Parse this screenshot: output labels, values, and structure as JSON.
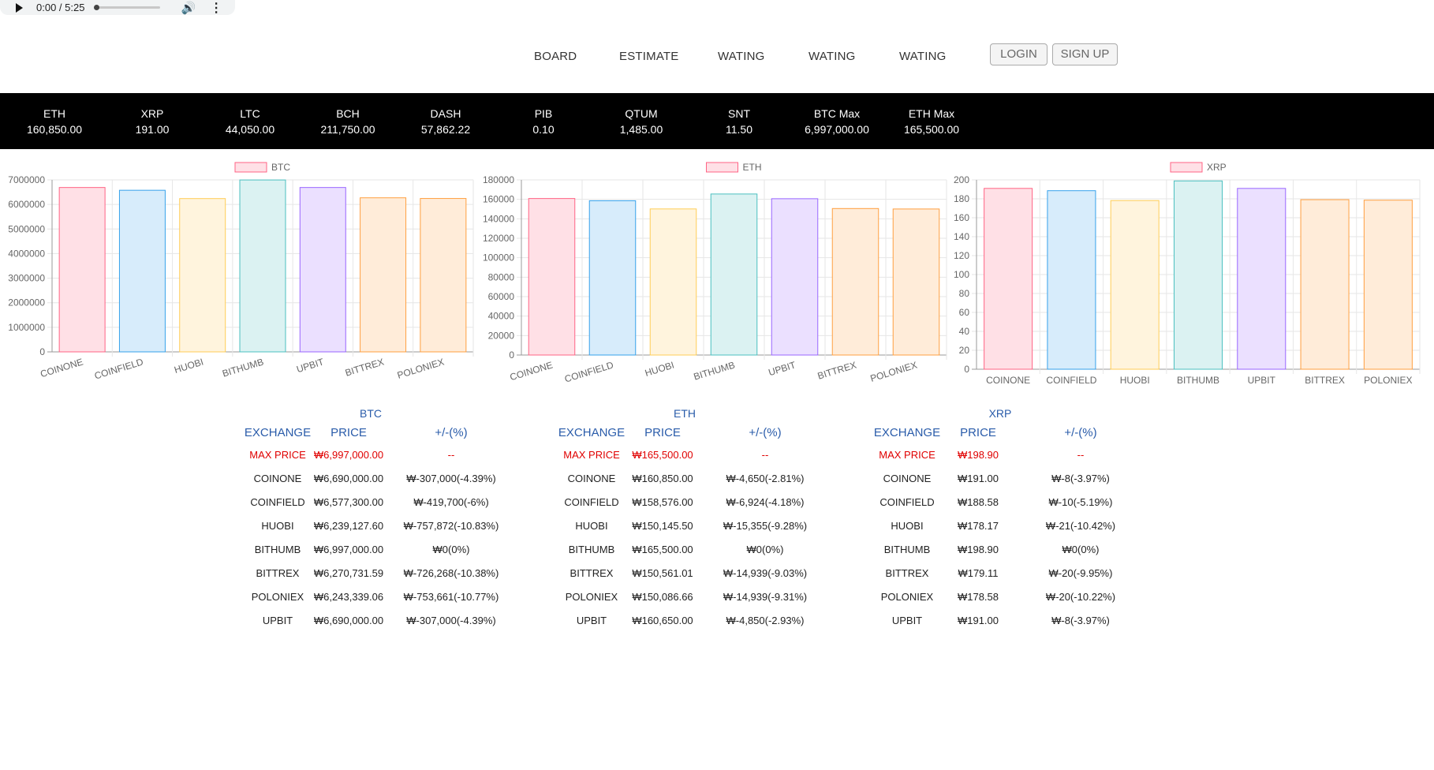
{
  "audio": {
    "time": "0:00 / 5:25"
  },
  "nav": {
    "items": [
      "BOARD",
      "ESTIMATE",
      "WATING",
      "WATING",
      "WATING"
    ],
    "login": "LOGIN",
    "signup": "SIGN UP"
  },
  "ticker": [
    {
      "name": "ETH",
      "value": "160,850.00"
    },
    {
      "name": "XRP",
      "value": "191.00"
    },
    {
      "name": "LTC",
      "value": "44,050.00"
    },
    {
      "name": "BCH",
      "value": "211,750.00"
    },
    {
      "name": "DASH",
      "value": "57,862.22"
    },
    {
      "name": "PIB",
      "value": "0.10"
    },
    {
      "name": "QTUM",
      "value": "1,485.00"
    },
    {
      "name": "SNT",
      "value": "11.50"
    },
    {
      "name": "BTC Max",
      "value": "6,997,000.00"
    },
    {
      "name": "ETH Max",
      "value": "165,500.00"
    }
  ],
  "colors": {
    "fills": [
      "#ffe0e6",
      "#d7ecfb",
      "#fff4dd",
      "#dbf2f2",
      "#ebe0ff",
      "#ffecd9",
      "#ffecd9"
    ],
    "strokes": [
      "#ff6384",
      "#36a2eb",
      "#ffcd56",
      "#4bc0c0",
      "#9966ff",
      "#ff9f40",
      "#ff9f40"
    ],
    "max": "#e00000",
    "header": "#2a5caa"
  },
  "chart_data": [
    {
      "type": "bar",
      "title": "",
      "series": [
        {
          "name": "BTC",
          "values": [
            6690000,
            6577300,
            6239127.6,
            6997000,
            6690000,
            6270731.59,
            6243339.06
          ]
        }
      ],
      "categories": [
        "COINONE",
        "COINFIELD",
        "HUOBI",
        "BITHUMB",
        "UPBIT",
        "BITTREX",
        "POLONIEX"
      ],
      "yticks": [
        "0",
        "1000000",
        "2000000",
        "3000000",
        "4000000",
        "5000000",
        "6000000",
        "7000000"
      ],
      "ylim": [
        0,
        7000000
      ],
      "grid": true,
      "legend": "top"
    },
    {
      "type": "bar",
      "title": "",
      "series": [
        {
          "name": "ETH",
          "values": [
            160850,
            158576,
            150145.5,
            165500,
            160650,
            150561.01,
            150086.66
          ]
        }
      ],
      "categories": [
        "COINONE",
        "COINFIELD",
        "HUOBI",
        "BITHUMB",
        "UPBIT",
        "BITTREX",
        "POLONIEX"
      ],
      "yticks": [
        "0",
        "20000",
        "40000",
        "60000",
        "80000",
        "100000",
        "120000",
        "140000",
        "160000",
        "180000"
      ],
      "ylim": [
        0,
        180000
      ],
      "grid": true,
      "legend": "top"
    },
    {
      "type": "bar",
      "title": "",
      "series": [
        {
          "name": "XRP",
          "values": [
            191,
            188.58,
            178.17,
            198.9,
            191,
            179.11,
            178.58
          ]
        }
      ],
      "categories": [
        "COINONE",
        "COINFIELD",
        "HUOBI",
        "BITHUMB",
        "UPBIT",
        "BITTREX",
        "POLONIEX"
      ],
      "yticks": [
        "0",
        "20",
        "40",
        "60",
        "80",
        "100",
        "120",
        "140",
        "160",
        "180",
        "200"
      ],
      "ylim": [
        0,
        200
      ],
      "grid": true,
      "legend": "top"
    }
  ],
  "tables": [
    {
      "title": "BTC",
      "headers": [
        "EXCHANGE",
        "PRICE",
        "+/-(%)"
      ],
      "rows": [
        [
          "MAX PRICE",
          "₩6,997,000.00",
          "--"
        ],
        [
          "COINONE",
          "₩6,690,000.00",
          "₩-307,000(-4.39%)"
        ],
        [
          "COINFIELD",
          "₩6,577,300.00",
          "₩-419,700(-6%)"
        ],
        [
          "HUOBI",
          "₩6,239,127.60",
          "₩-757,872(-10.83%)"
        ],
        [
          "BITHUMB",
          "₩6,997,000.00",
          "₩0(0%)"
        ],
        [
          "BITTREX",
          "₩6,270,731.59",
          "₩-726,268(-10.38%)"
        ],
        [
          "POLONIEX",
          "₩6,243,339.06",
          "₩-753,661(-10.77%)"
        ],
        [
          "UPBIT",
          "₩6,690,000.00",
          "₩-307,000(-4.39%)"
        ]
      ]
    },
    {
      "title": "ETH",
      "headers": [
        "EXCHANGE",
        "PRICE",
        "+/-(%)"
      ],
      "rows": [
        [
          "MAX PRICE",
          "₩165,500.00",
          "--"
        ],
        [
          "COINONE",
          "₩160,850.00",
          "₩-4,650(-2.81%)"
        ],
        [
          "COINFIELD",
          "₩158,576.00",
          "₩-6,924(-4.18%)"
        ],
        [
          "HUOBI",
          "₩150,145.50",
          "₩-15,355(-9.28%)"
        ],
        [
          "BITHUMB",
          "₩165,500.00",
          "₩0(0%)"
        ],
        [
          "BITTREX",
          "₩150,561.01",
          "₩-14,939(-9.03%)"
        ],
        [
          "POLONIEX",
          "₩150,086.66",
          "₩-14,939(-9.31%)"
        ],
        [
          "UPBIT",
          "₩160,650.00",
          "₩-4,850(-2.93%)"
        ]
      ]
    },
    {
      "title": "XRP",
      "headers": [
        "EXCHANGE",
        "PRICE",
        "+/-(%)"
      ],
      "rows": [
        [
          "MAX PRICE",
          "₩198.90",
          "--"
        ],
        [
          "COINONE",
          "₩191.00",
          "₩-8(-3.97%)"
        ],
        [
          "COINFIELD",
          "₩188.58",
          "₩-10(-5.19%)"
        ],
        [
          "HUOBI",
          "₩178.17",
          "₩-21(-10.42%)"
        ],
        [
          "BITHUMB",
          "₩198.90",
          "₩0(0%)"
        ],
        [
          "BITTREX",
          "₩179.11",
          "₩-20(-9.95%)"
        ],
        [
          "POLONIEX",
          "₩178.58",
          "₩-20(-10.22%)"
        ],
        [
          "UPBIT",
          "₩191.00",
          "₩-8(-3.97%)"
        ]
      ]
    }
  ]
}
